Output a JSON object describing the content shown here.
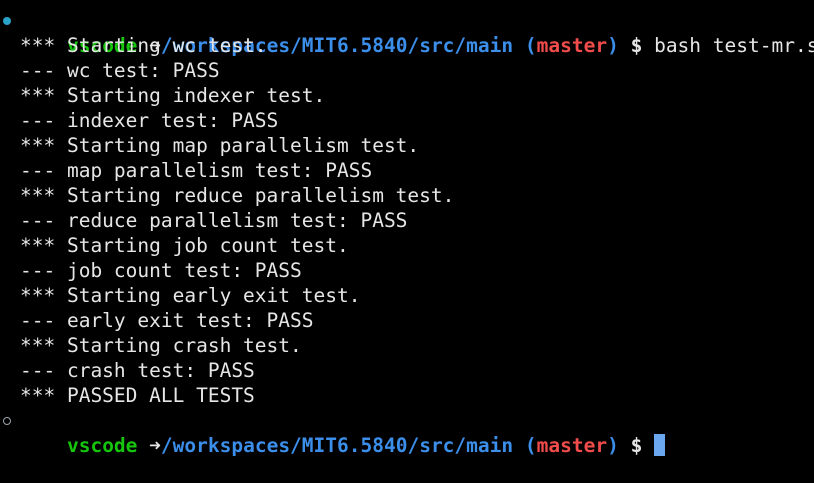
{
  "colors": {
    "background": "#000000",
    "user": "#16c60c",
    "path": "#3b8eea",
    "branch": "#f14c4c",
    "text": "#e6e6e6",
    "cursor": "#6aa7ee",
    "status_dot_active": "#2aa3c9"
  },
  "prompt1": {
    "status_icon": "circle-filled-icon",
    "user": "vscode",
    "arrow": "➜",
    "path": "/workspaces/MIT6.5840/src/main",
    "git_open": "(",
    "branch": "master",
    "git_close": ")",
    "dollar": "$",
    "command": "bash test-mr.sh"
  },
  "output": [
    "*** Starting wc test.",
    "--- wc test: PASS",
    "*** Starting indexer test.",
    "--- indexer test: PASS",
    "*** Starting map parallelism test.",
    "--- map parallelism test: PASS",
    "*** Starting reduce parallelism test.",
    "--- reduce parallelism test: PASS",
    "*** Starting job count test.",
    "--- job count test: PASS",
    "*** Starting early exit test.",
    "--- early exit test: PASS",
    "*** Starting crash test.",
    "--- crash test: PASS",
    "*** PASSED ALL TESTS"
  ],
  "prompt2": {
    "status_icon": "circle-hollow-icon",
    "user": "vscode",
    "arrow": "➜",
    "path": "/workspaces/MIT6.5840/src/main",
    "git_open": "(",
    "branch": "master",
    "git_close": ")",
    "dollar": "$"
  }
}
